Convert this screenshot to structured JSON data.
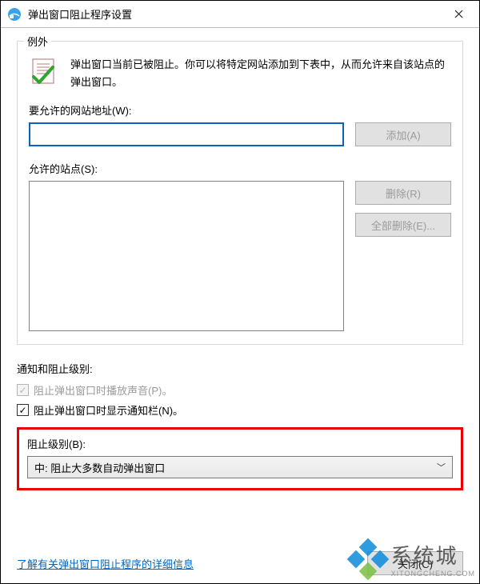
{
  "titlebar": {
    "title": "弹出窗口阻止程序设置"
  },
  "exceptions": {
    "group_title": "例外",
    "intro": "弹出窗口当前已被阻止。你可以将特定网站添加到下表中，从而允许来自该站点的弹出窗口。",
    "address_label": "要允许的网站地址(W):",
    "address_value": "",
    "add_btn": "添加(A)",
    "sites_label": "允许的站点(S):",
    "remove_btn": "删除(R)",
    "remove_all_btn": "全部删除(E)..."
  },
  "notify": {
    "section_label": "通知和阻止级别:",
    "sound_checked": true,
    "sound_label": "阻止弹出窗口时播放声音(P)。",
    "bar_checked": true,
    "bar_label": "阻止弹出窗口时显示通知栏(N)。",
    "level_label": "阻止级别(B):",
    "level_value": "中: 阻止大多数自动弹出窗口"
  },
  "footer": {
    "link": "了解有关弹出窗口阻止程序的详细信息",
    "close_btn": "关闭(C)"
  },
  "watermark": {
    "brand": "系统城",
    "domain": "XITONGCHENG.COM"
  }
}
